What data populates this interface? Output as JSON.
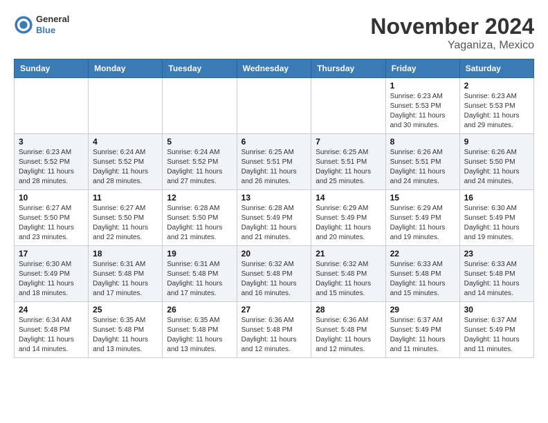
{
  "header": {
    "logo_general": "General",
    "logo_blue": "Blue",
    "month_title": "November 2024",
    "location": "Yaganiza, Mexico"
  },
  "weekdays": [
    "Sunday",
    "Monday",
    "Tuesday",
    "Wednesday",
    "Thursday",
    "Friday",
    "Saturday"
  ],
  "weeks": [
    [
      {
        "day": "",
        "info": ""
      },
      {
        "day": "",
        "info": ""
      },
      {
        "day": "",
        "info": ""
      },
      {
        "day": "",
        "info": ""
      },
      {
        "day": "",
        "info": ""
      },
      {
        "day": "1",
        "info": "Sunrise: 6:23 AM\nSunset: 5:53 PM\nDaylight: 11 hours and 30 minutes."
      },
      {
        "day": "2",
        "info": "Sunrise: 6:23 AM\nSunset: 5:53 PM\nDaylight: 11 hours and 29 minutes."
      }
    ],
    [
      {
        "day": "3",
        "info": "Sunrise: 6:23 AM\nSunset: 5:52 PM\nDaylight: 11 hours and 28 minutes."
      },
      {
        "day": "4",
        "info": "Sunrise: 6:24 AM\nSunset: 5:52 PM\nDaylight: 11 hours and 28 minutes."
      },
      {
        "day": "5",
        "info": "Sunrise: 6:24 AM\nSunset: 5:52 PM\nDaylight: 11 hours and 27 minutes."
      },
      {
        "day": "6",
        "info": "Sunrise: 6:25 AM\nSunset: 5:51 PM\nDaylight: 11 hours and 26 minutes."
      },
      {
        "day": "7",
        "info": "Sunrise: 6:25 AM\nSunset: 5:51 PM\nDaylight: 11 hours and 25 minutes."
      },
      {
        "day": "8",
        "info": "Sunrise: 6:26 AM\nSunset: 5:51 PM\nDaylight: 11 hours and 24 minutes."
      },
      {
        "day": "9",
        "info": "Sunrise: 6:26 AM\nSunset: 5:50 PM\nDaylight: 11 hours and 24 minutes."
      }
    ],
    [
      {
        "day": "10",
        "info": "Sunrise: 6:27 AM\nSunset: 5:50 PM\nDaylight: 11 hours and 23 minutes."
      },
      {
        "day": "11",
        "info": "Sunrise: 6:27 AM\nSunset: 5:50 PM\nDaylight: 11 hours and 22 minutes."
      },
      {
        "day": "12",
        "info": "Sunrise: 6:28 AM\nSunset: 5:50 PM\nDaylight: 11 hours and 21 minutes."
      },
      {
        "day": "13",
        "info": "Sunrise: 6:28 AM\nSunset: 5:49 PM\nDaylight: 11 hours and 21 minutes."
      },
      {
        "day": "14",
        "info": "Sunrise: 6:29 AM\nSunset: 5:49 PM\nDaylight: 11 hours and 20 minutes."
      },
      {
        "day": "15",
        "info": "Sunrise: 6:29 AM\nSunset: 5:49 PM\nDaylight: 11 hours and 19 minutes."
      },
      {
        "day": "16",
        "info": "Sunrise: 6:30 AM\nSunset: 5:49 PM\nDaylight: 11 hours and 19 minutes."
      }
    ],
    [
      {
        "day": "17",
        "info": "Sunrise: 6:30 AM\nSunset: 5:49 PM\nDaylight: 11 hours and 18 minutes."
      },
      {
        "day": "18",
        "info": "Sunrise: 6:31 AM\nSunset: 5:48 PM\nDaylight: 11 hours and 17 minutes."
      },
      {
        "day": "19",
        "info": "Sunrise: 6:31 AM\nSunset: 5:48 PM\nDaylight: 11 hours and 17 minutes."
      },
      {
        "day": "20",
        "info": "Sunrise: 6:32 AM\nSunset: 5:48 PM\nDaylight: 11 hours and 16 minutes."
      },
      {
        "day": "21",
        "info": "Sunrise: 6:32 AM\nSunset: 5:48 PM\nDaylight: 11 hours and 15 minutes."
      },
      {
        "day": "22",
        "info": "Sunrise: 6:33 AM\nSunset: 5:48 PM\nDaylight: 11 hours and 15 minutes."
      },
      {
        "day": "23",
        "info": "Sunrise: 6:33 AM\nSunset: 5:48 PM\nDaylight: 11 hours and 14 minutes."
      }
    ],
    [
      {
        "day": "24",
        "info": "Sunrise: 6:34 AM\nSunset: 5:48 PM\nDaylight: 11 hours and 14 minutes."
      },
      {
        "day": "25",
        "info": "Sunrise: 6:35 AM\nSunset: 5:48 PM\nDaylight: 11 hours and 13 minutes."
      },
      {
        "day": "26",
        "info": "Sunrise: 6:35 AM\nSunset: 5:48 PM\nDaylight: 11 hours and 13 minutes."
      },
      {
        "day": "27",
        "info": "Sunrise: 6:36 AM\nSunset: 5:48 PM\nDaylight: 11 hours and 12 minutes."
      },
      {
        "day": "28",
        "info": "Sunrise: 6:36 AM\nSunset: 5:48 PM\nDaylight: 11 hours and 12 minutes."
      },
      {
        "day": "29",
        "info": "Sunrise: 6:37 AM\nSunset: 5:49 PM\nDaylight: 11 hours and 11 minutes."
      },
      {
        "day": "30",
        "info": "Sunrise: 6:37 AM\nSunset: 5:49 PM\nDaylight: 11 hours and 11 minutes."
      }
    ]
  ]
}
